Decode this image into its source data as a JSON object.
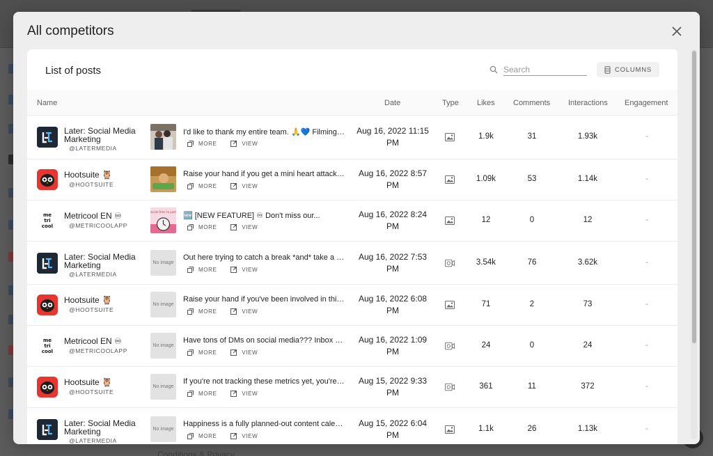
{
  "modal": {
    "title": "All competitors",
    "close_icon": "close-icon"
  },
  "card": {
    "title": "List of posts",
    "search_placeholder": "Search",
    "columns_label": "COLUMNS"
  },
  "table": {
    "columns": [
      "Name",
      "Date",
      "Type",
      "Likes",
      "Comments",
      "Interactions",
      "Engagement"
    ],
    "more_label": "MORE",
    "view_label": "VIEW",
    "no_image_label": "No image",
    "rows": [
      {
        "account": "Later: Social Media Marketing",
        "brand": "later",
        "handle": "@LATERMEDIA",
        "thumb": "photo",
        "text": "I'd like to thank my entire team. 🙏💙   Filming when I'm nervous",
        "date": "Aug 16, 2022 11:15 PM",
        "type": "image",
        "likes": "1.9k",
        "comments": "31",
        "interactions": "1.93k",
        "engagement": "-"
      },
      {
        "account": "Hootsuite 🦉",
        "brand": "hootsuite",
        "handle": "@HOOTSUITE",
        "thumb": "photo",
        "text": "Raise your hand if you get a mini heart attack every time",
        "date": "Aug 16, 2022 8:57 PM",
        "type": "image",
        "likes": "1.09k",
        "comments": "53",
        "interactions": "1.14k",
        "engagement": "-"
      },
      {
        "account": "Metricool EN ♾",
        "brand": "metricool",
        "handle": "@METRICOOLAPP",
        "thumb": "photo",
        "text": "🆕 [NEW FEATURE] ♾ Don't miss our...",
        "date": "Aug 16, 2022 8:24 PM",
        "type": "image",
        "likes": "12",
        "comments": "0",
        "interactions": "12",
        "engagement": "-"
      },
      {
        "account": "Later: Social Media Marketing",
        "brand": "later",
        "handle": "@LATERMEDIA",
        "thumb": "none",
        "text": "Out here trying to catch a break *and* take a nap",
        "date": "Aug 16, 2022 7:53 PM",
        "type": "video",
        "likes": "3.54k",
        "comments": "76",
        "interactions": "3.62k",
        "engagement": "-"
      },
      {
        "account": "Hootsuite 🦉",
        "brand": "hootsuite",
        "handle": "@HOOTSUITE",
        "thumb": "none",
        "text": "Raise your hand if you've been involved in this situation",
        "date": "Aug 16, 2022 6:08 PM",
        "type": "image",
        "likes": "71",
        "comments": "2",
        "interactions": "73",
        "engagement": "-"
      },
      {
        "account": "Metricool EN ♾",
        "brand": "metricool",
        "handle": "@METRICOOLAPP",
        "thumb": "none",
        "text": "Have tons of DMs on social media??? Inbox zero",
        "date": "Aug 16, 2022 1:09 PM",
        "type": "video",
        "likes": "24",
        "comments": "0",
        "interactions": "24",
        "engagement": "-"
      },
      {
        "account": "Hootsuite 🦉",
        "brand": "hootsuite",
        "handle": "@HOOTSUITE",
        "thumb": "none",
        "text": "If you're not tracking these metrics yet, you're missing out",
        "date": "Aug 15, 2022 9:33 PM",
        "type": "video",
        "likes": "361",
        "comments": "11",
        "interactions": "372",
        "engagement": "-"
      },
      {
        "account": "Later: Social Media Marketing",
        "brand": "later",
        "handle": "@LATERMEDIA",
        "thumb": "none",
        "text": "Happiness is a fully planned-out content calendar...",
        "date": "Aug 15, 2022 6:04 PM",
        "type": "image",
        "likes": "1.1k",
        "comments": "26",
        "interactions": "1.13k",
        "engagement": "-"
      }
    ]
  },
  "background": {
    "footer_text": "Conditions & Privacy"
  }
}
